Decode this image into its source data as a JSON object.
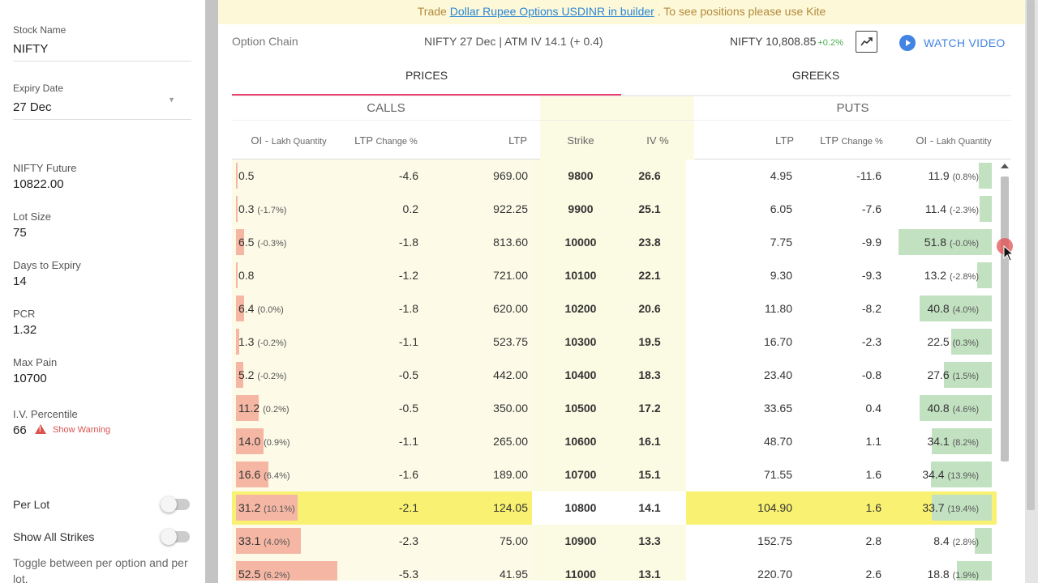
{
  "colors": {
    "ce_oi_bar": "#f5b7a4",
    "pe_oi_bar": "#c2e1c1",
    "ce_bg": "#fdfbe8",
    "strike_bg": "#fbfae3",
    "atm_highlight": "#f8f171",
    "tab_accent": "#e83e6c",
    "link_blue": "#4184e4",
    "banner_bg": "#fdf8d8"
  },
  "sidebar": {
    "stock_name_label": "Stock Name",
    "stock_name_value": "NIFTY",
    "expiry_label": "Expiry Date",
    "expiry_value": "27 Dec",
    "future_label": "NIFTY Future",
    "future_value": "10822.00",
    "lot_label": "Lot Size",
    "lot_value": "75",
    "days_label": "Days to Expiry",
    "days_value": "14",
    "pcr_label": "PCR",
    "pcr_value": "1.32",
    "maxpain_label": "Max Pain",
    "maxpain_value": "10700",
    "ivp_label": "I.V. Percentile",
    "ivp_value": "66",
    "ivp_warning": "Show Warning",
    "per_lot_label": "Per Lot",
    "show_all_label": "Show All Strikes",
    "toggle_desc": "Toggle between per option and per lot."
  },
  "banner": {
    "prefix": "Trade ",
    "link": "Dollar Rupee Options USDINR in builder",
    "suffix": " . To see positions please use Kite"
  },
  "header": {
    "title": "Option Chain",
    "center": "NIFTY 27 Dec | ATM IV 14.1 (+ 0.4)",
    "index": "NIFTY 10,808.85",
    "index_change": "+0.2%",
    "watch": "WATCH VIDEO"
  },
  "tabs": {
    "prices": "PRICES",
    "greeks": "GREEKS"
  },
  "table": {
    "calls": "CALLS",
    "puts": "PUTS",
    "oi_label": "OI - ",
    "oi_small": "Lakh Quantity",
    "ltp_chg_label": "LTP ",
    "ltp_chg_small": "Change %",
    "ltp": "LTP",
    "strike": "Strike",
    "iv": "IV %",
    "rows": [
      {
        "ce_oi": "0.5",
        "ce_oi_chg": "",
        "ce_oi_frac": 0.004,
        "ce_chg": "-4.6",
        "ce_ltp": "969.00",
        "strike": "9800",
        "iv": "26.6",
        "pe_ltp": "4.95",
        "pe_chg": "-11.6",
        "pe_oi": "11.9",
        "pe_oi_chg": "(0.8%)",
        "pe_oi_frac": 0.13,
        "atm": false
      },
      {
        "ce_oi": "0.3",
        "ce_oi_chg": "(-1.7%)",
        "ce_oi_frac": 0.004,
        "ce_chg": "0.2",
        "ce_ltp": "922.25",
        "strike": "9900",
        "iv": "25.1",
        "pe_ltp": "6.05",
        "pe_chg": "-7.6",
        "pe_oi": "11.4",
        "pe_oi_chg": "(-2.3%)",
        "pe_oi_frac": 0.12,
        "atm": false
      },
      {
        "ce_oi": "6.5",
        "ce_oi_chg": "(-0.3%)",
        "ce_oi_frac": 0.08,
        "ce_chg": "-1.8",
        "ce_ltp": "813.60",
        "strike": "10000",
        "iv": "23.8",
        "pe_ltp": "7.75",
        "pe_chg": "-9.9",
        "pe_oi": "51.8",
        "pe_oi_chg": "(-0.0%)",
        "pe_oi_frac": 0.92,
        "atm": false
      },
      {
        "ce_oi": "0.8",
        "ce_oi_chg": "",
        "ce_oi_frac": 0.006,
        "ce_chg": "-1.2",
        "ce_ltp": "721.00",
        "strike": "10100",
        "iv": "22.1",
        "pe_ltp": "9.30",
        "pe_chg": "-9.3",
        "pe_oi": "13.2",
        "pe_oi_chg": "(-2.8%)",
        "pe_oi_frac": 0.14,
        "atm": false
      },
      {
        "ce_oi": "6.4",
        "ce_oi_chg": "(0.0%)",
        "ce_oi_frac": 0.08,
        "ce_chg": "-1.8",
        "ce_ltp": "620.00",
        "strike": "10200",
        "iv": "20.6",
        "pe_ltp": "11.80",
        "pe_chg": "-8.2",
        "pe_oi": "40.8",
        "pe_oi_chg": "(4.0%)",
        "pe_oi_frac": 0.71,
        "atm": false
      },
      {
        "ce_oi": "1.3",
        "ce_oi_chg": "(-0.2%)",
        "ce_oi_frac": 0.03,
        "ce_chg": "-1.1",
        "ce_ltp": "523.75",
        "strike": "10300",
        "iv": "19.5",
        "pe_ltp": "16.70",
        "pe_chg": "-2.3",
        "pe_oi": "22.5",
        "pe_oi_chg": "(0.3%)",
        "pe_oi_frac": 0.4,
        "atm": false
      },
      {
        "ce_oi": "5.2",
        "ce_oi_chg": "(-0.2%)",
        "ce_oi_frac": 0.07,
        "ce_chg": "-0.5",
        "ce_ltp": "442.00",
        "strike": "10400",
        "iv": "18.3",
        "pe_ltp": "23.40",
        "pe_chg": "-0.8",
        "pe_oi": "27.6",
        "pe_oi_chg": "(1.5%)",
        "pe_oi_frac": 0.47,
        "atm": false
      },
      {
        "ce_oi": "11.2",
        "ce_oi_chg": "(0.2%)",
        "ce_oi_frac": 0.22,
        "ce_chg": "-0.5",
        "ce_ltp": "350.00",
        "strike": "10500",
        "iv": "17.2",
        "pe_ltp": "33.65",
        "pe_chg": "0.4",
        "pe_oi": "40.8",
        "pe_oi_chg": "(4.6%)",
        "pe_oi_frac": 0.71,
        "atm": false
      },
      {
        "ce_oi": "14.0",
        "ce_oi_chg": "(0.9%)",
        "ce_oi_frac": 0.27,
        "ce_chg": "-1.1",
        "ce_ltp": "265.00",
        "strike": "10600",
        "iv": "16.1",
        "pe_ltp": "48.70",
        "pe_chg": "1.1",
        "pe_oi": "34.1",
        "pe_oi_chg": "(8.2%)",
        "pe_oi_frac": 0.59,
        "atm": false
      },
      {
        "ce_oi": "16.6",
        "ce_oi_chg": "(6.4%)",
        "ce_oi_frac": 0.32,
        "ce_chg": "-1.6",
        "ce_ltp": "189.00",
        "strike": "10700",
        "iv": "15.1",
        "pe_ltp": "71.55",
        "pe_chg": "1.6",
        "pe_oi": "34.4",
        "pe_oi_chg": "(13.9%)",
        "pe_oi_frac": 0.6,
        "atm": false
      },
      {
        "ce_oi": "31.2",
        "ce_oi_chg": "(10.1%)",
        "ce_oi_frac": 0.61,
        "ce_chg": "-2.1",
        "ce_ltp": "124.05",
        "strike": "10800",
        "iv": "14.1",
        "pe_ltp": "104.90",
        "pe_chg": "1.6",
        "pe_oi": "33.7",
        "pe_oi_chg": "(19.4%)",
        "pe_oi_frac": 0.59,
        "atm": true
      },
      {
        "ce_oi": "33.1",
        "ce_oi_chg": "(4.0%)",
        "ce_oi_frac": 0.64,
        "ce_chg": "-2.3",
        "ce_ltp": "75.00",
        "strike": "10900",
        "iv": "13.3",
        "pe_ltp": "152.75",
        "pe_chg": "2.8",
        "pe_oi": "8.4",
        "pe_oi_chg": "(2.8%)",
        "pe_oi_frac": 0.17,
        "atm": false
      },
      {
        "ce_oi": "52.5",
        "ce_oi_chg": "(6.2%)",
        "ce_oi_frac": 1.0,
        "ce_chg": "-5.3",
        "ce_ltp": "41.95",
        "strike": "11000",
        "iv": "13.1",
        "pe_ltp": "220.70",
        "pe_chg": "2.6",
        "pe_oi": "18.8",
        "pe_oi_chg": "(1.9%)",
        "pe_oi_frac": 0.34,
        "atm": false
      }
    ]
  }
}
